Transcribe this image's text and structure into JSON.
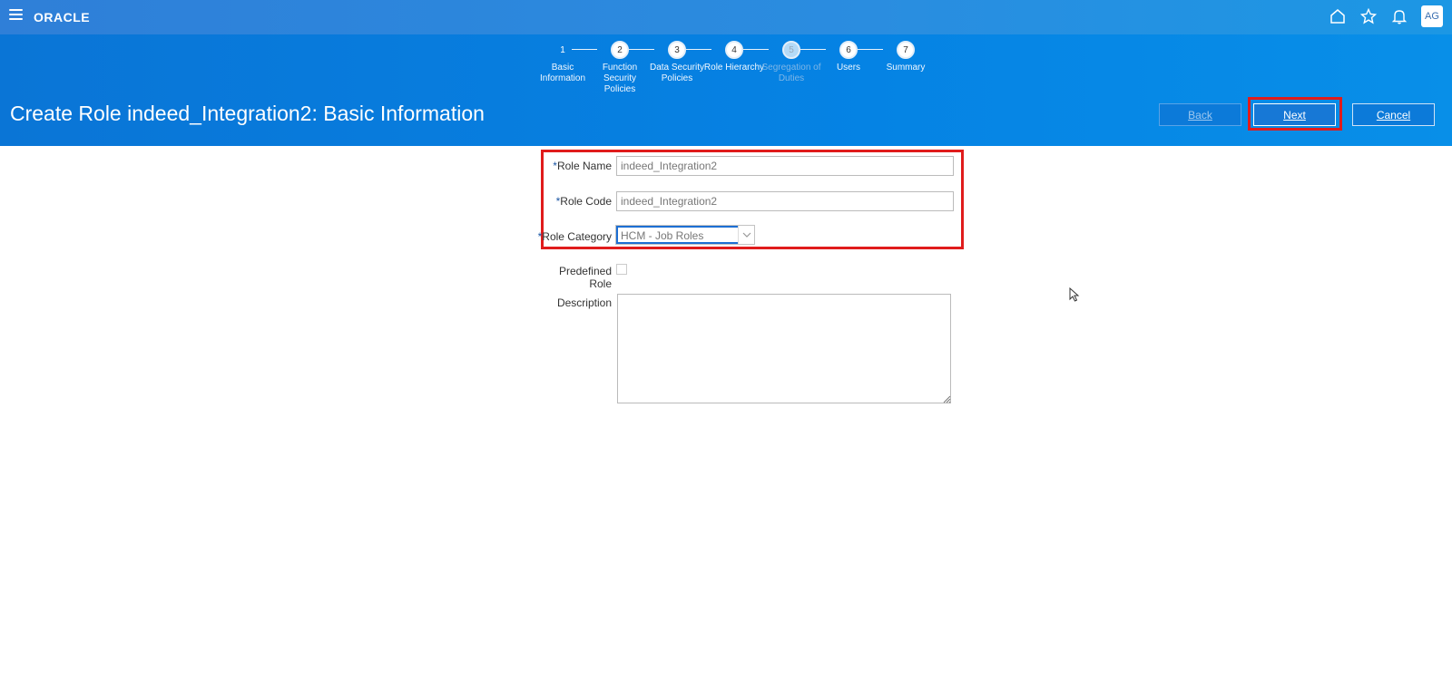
{
  "app": {
    "logo": "ORACLE",
    "user_initials": "AG"
  },
  "train": {
    "stops": [
      {
        "num": "1",
        "label": "Basic Information",
        "state": "current"
      },
      {
        "num": "2",
        "label": "Function Security Policies",
        "state": "normal"
      },
      {
        "num": "3",
        "label": "Data Security Policies",
        "state": "normal"
      },
      {
        "num": "4",
        "label": "Role Hierarchy",
        "state": "normal"
      },
      {
        "num": "5",
        "label": "Segregation of Duties",
        "state": "disabled"
      },
      {
        "num": "6",
        "label": "Users",
        "state": "normal"
      },
      {
        "num": "7",
        "label": "Summary",
        "state": "normal"
      }
    ]
  },
  "page": {
    "title": "Create Role indeed_Integration2: Basic Information"
  },
  "actions": {
    "back": "Back",
    "next": "Next",
    "cancel": "Cancel"
  },
  "form": {
    "role_name": {
      "label": "Role Name",
      "value": "indeed_Integration2"
    },
    "role_code": {
      "label": "Role Code",
      "value": "indeed_Integration2"
    },
    "role_category": {
      "label": "Role Category",
      "value": "HCM - Job Roles"
    },
    "predefined_role": {
      "label": "Predefined Role",
      "checked": false
    },
    "description": {
      "label": "Description",
      "value": ""
    },
    "required_marker": "*"
  }
}
